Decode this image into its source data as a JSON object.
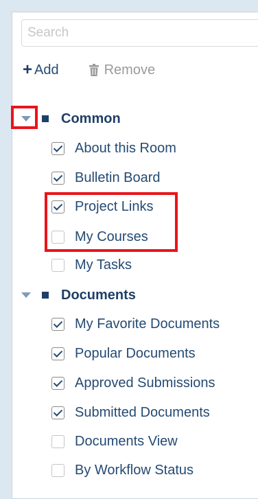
{
  "search": {
    "placeholder": "Search",
    "value": ""
  },
  "toolbar": {
    "add_label": "Add",
    "remove_label": "Remove"
  },
  "groups": [
    {
      "label": "Common",
      "items": [
        {
          "label": "About this Room",
          "checked": true
        },
        {
          "label": "Bulletin Board",
          "checked": true
        },
        {
          "label": "Project Links",
          "checked": true
        },
        {
          "label": "My Courses",
          "checked": false
        },
        {
          "label": "My Tasks",
          "checked": false
        }
      ]
    },
    {
      "label": "Documents",
      "items": [
        {
          "label": "My Favorite Documents",
          "checked": true
        },
        {
          "label": "Popular Documents",
          "checked": true
        },
        {
          "label": "Approved Submissions",
          "checked": true
        },
        {
          "label": "Submitted Documents",
          "checked": true
        },
        {
          "label": "Documents View",
          "checked": false
        },
        {
          "label": "By Workflow Status",
          "checked": false
        }
      ]
    }
  ],
  "colors": {
    "accent": "#1f3f66",
    "text": "#244a73",
    "highlight": "#e8141b",
    "background": "#dbe8f2"
  }
}
